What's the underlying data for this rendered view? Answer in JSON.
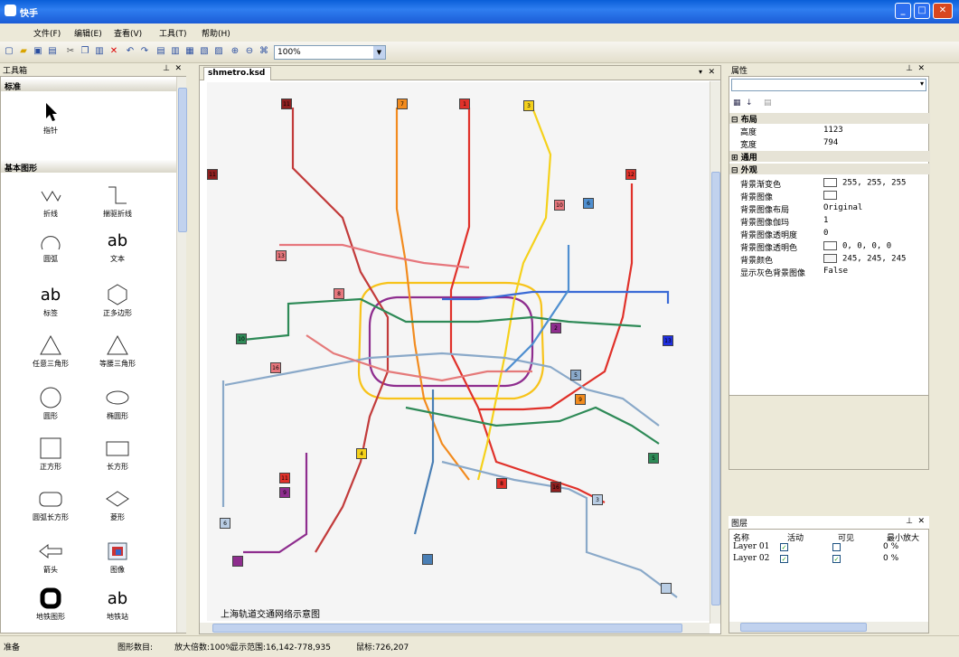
{
  "window": {
    "title": "快手"
  },
  "menu": [
    "文件(F)",
    "编辑(E)",
    "查看(V)",
    "工具(T)",
    "帮助(H)"
  ],
  "toolbar": {
    "zoom": "100%"
  },
  "toolbox": {
    "title": "工具箱",
    "section_standard": "标准",
    "section_basic": "基本图形",
    "pointer": "指针",
    "tools": [
      "折线",
      "揣驱折线",
      "圆弧",
      "文本",
      "标签",
      "正多边形",
      "任意三角形",
      "等腰三角形",
      "圆形",
      "椭圆形",
      "正方形",
      "长方形",
      "圆弧长方形",
      "菱形",
      "箭头",
      "图像",
      "地铁图形",
      "地铁站"
    ]
  },
  "document": {
    "tab": "shmetro.ksd",
    "map_caption": "上海轨道交通网络示意图",
    "station_labels": [
      "11",
      "7",
      "1",
      "3",
      "11",
      "12",
      "10",
      "6",
      "13",
      "8",
      "2",
      "13",
      "10",
      "16",
      "5",
      "9",
      "4",
      "5",
      "11",
      "9",
      "8",
      "16",
      "3",
      "6"
    ]
  },
  "properties": {
    "title": "属性",
    "cat_layout": "布局",
    "cat_general": "通用",
    "cat_appearance": "外观",
    "rows": [
      {
        "k": "高度",
        "v": "1123"
      },
      {
        "k": "宽度",
        "v": "794"
      },
      {
        "k": "背景渐变色",
        "v": "255, 255, 255"
      },
      {
        "k": "背景图像",
        "v": ""
      },
      {
        "k": "背景图像布局",
        "v": "Original"
      },
      {
        "k": "背景图像伽玛",
        "v": "1"
      },
      {
        "k": "背景图像透明度",
        "v": "0"
      },
      {
        "k": "背景图像透明色",
        "v": "0, 0, 0, 0"
      },
      {
        "k": "背景颜色",
        "v": "245, 245, 245"
      },
      {
        "k": "显示灰色背景图像",
        "v": "False"
      }
    ]
  },
  "layers": {
    "title": "图层",
    "headers": [
      "名称",
      "活动",
      "可见",
      "最小放大"
    ],
    "rows": [
      {
        "name": "Layer 01",
        "min": "0 %"
      },
      {
        "name": "Layer 02",
        "min": "0 %"
      }
    ]
  },
  "status": {
    "ready": "准备",
    "shape_count": "图形数目:",
    "zoom": "放大倍数:100%",
    "range": "显示范围:16,142-778,935",
    "mouse": "鼠标:726,207"
  }
}
